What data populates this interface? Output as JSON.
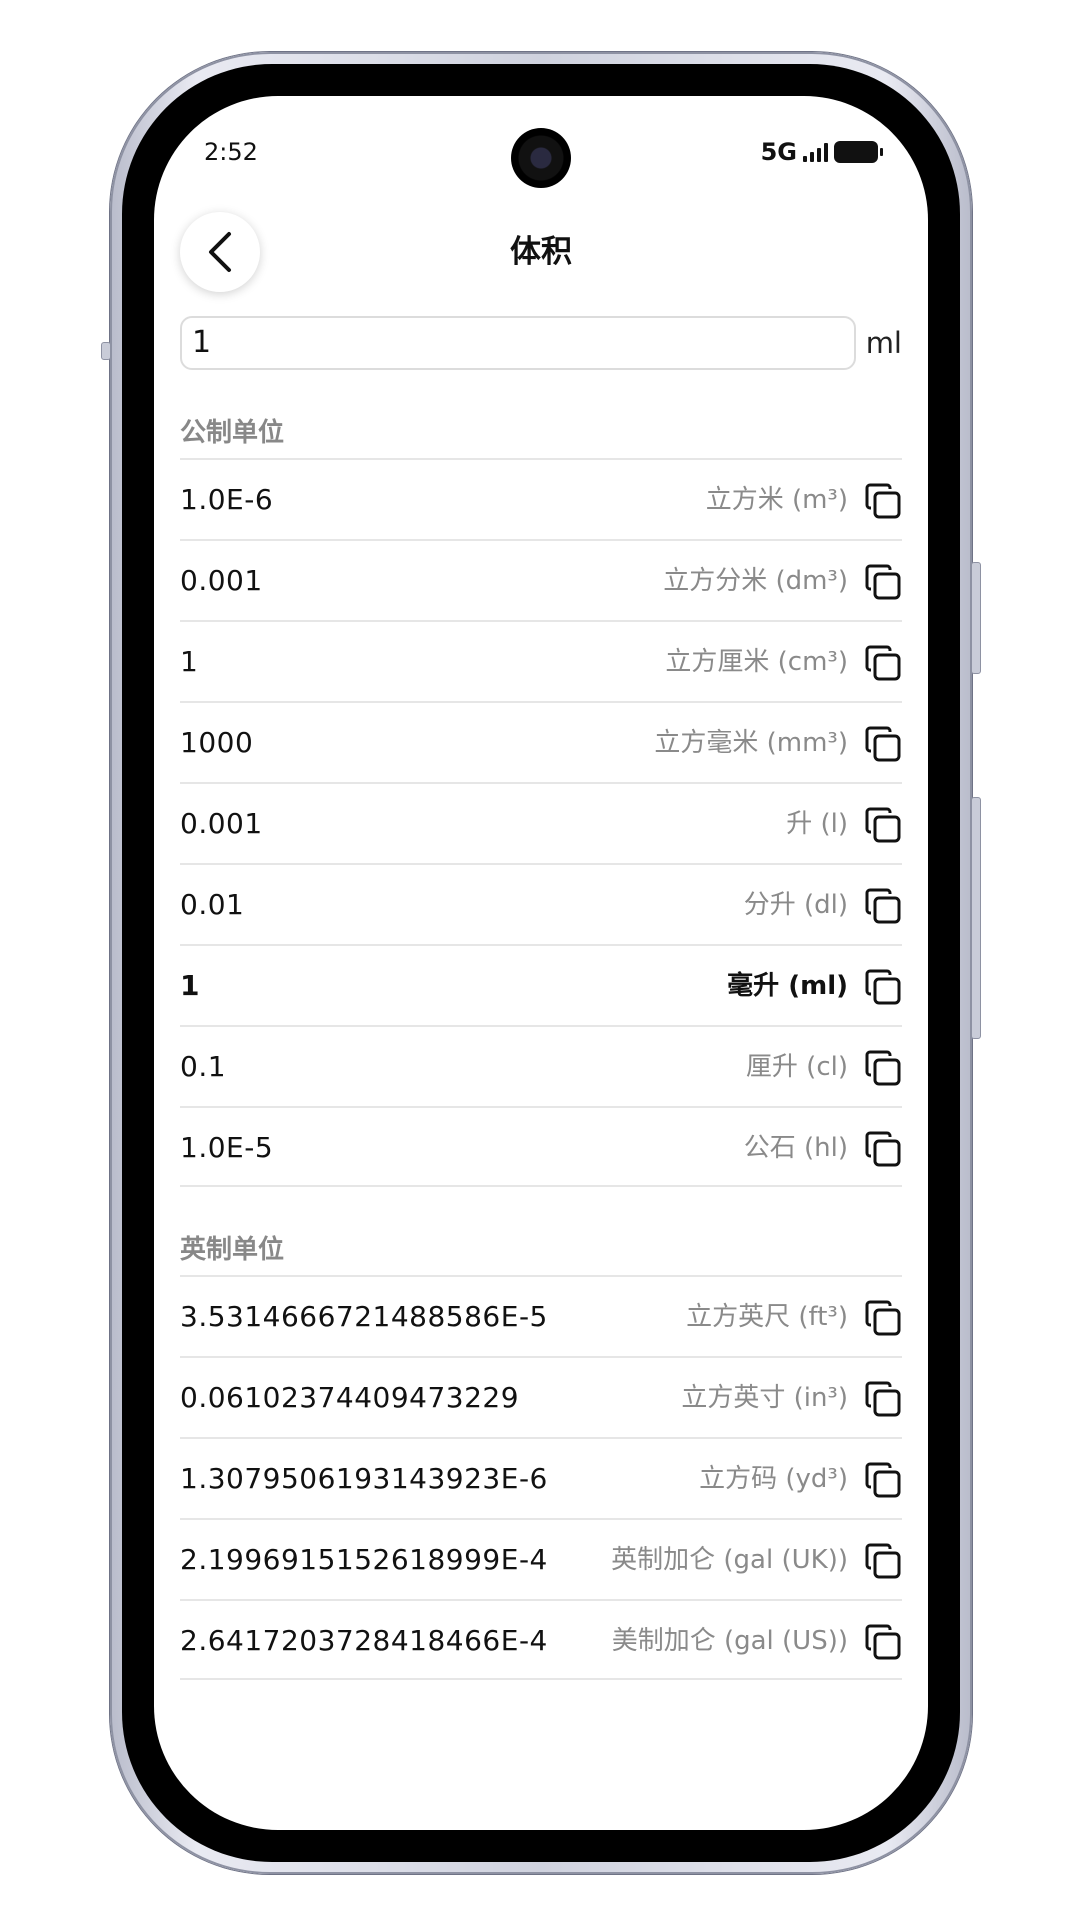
{
  "status": {
    "time": "2:52",
    "network": "5G"
  },
  "header": {
    "title": "体积"
  },
  "input": {
    "value": "1",
    "unit": "ml"
  },
  "sections": {
    "metric": {
      "title": "公制单位",
      "rows": [
        {
          "value": "1.0E-6",
          "unit": "立方米 (m³)"
        },
        {
          "value": "0.001",
          "unit": "立方分米 (dm³)"
        },
        {
          "value": "1",
          "unit": "立方厘米 (cm³)"
        },
        {
          "value": "1000",
          "unit": "立方毫米 (mm³)"
        },
        {
          "value": "0.001",
          "unit": "升 (l)"
        },
        {
          "value": "0.01",
          "unit": "分升 (dl)"
        },
        {
          "value": "1",
          "unit": "毫升 (ml)"
        },
        {
          "value": "0.1",
          "unit": "厘升 (cl)"
        },
        {
          "value": "1.0E-5",
          "unit": "公石 (hl)"
        }
      ]
    },
    "imperial": {
      "title": "英制单位",
      "rows": [
        {
          "value": "3.5314666721488586E-5",
          "unit": "立方英尺 (ft³)"
        },
        {
          "value": "0.06102374409473229",
          "unit": "立方英寸 (in³)"
        },
        {
          "value": "1.3079506193143923E-6",
          "unit": "立方码 (yd³)"
        },
        {
          "value": "2.1996915152618999E-4",
          "unit": "英制加仑 (gal (UK))"
        },
        {
          "value": "2.6417203728418466E-4",
          "unit": "美制加仑 (gal (US))"
        }
      ]
    }
  },
  "icons": {
    "back": "chevron-left-icon",
    "copy": "copy-icon"
  }
}
